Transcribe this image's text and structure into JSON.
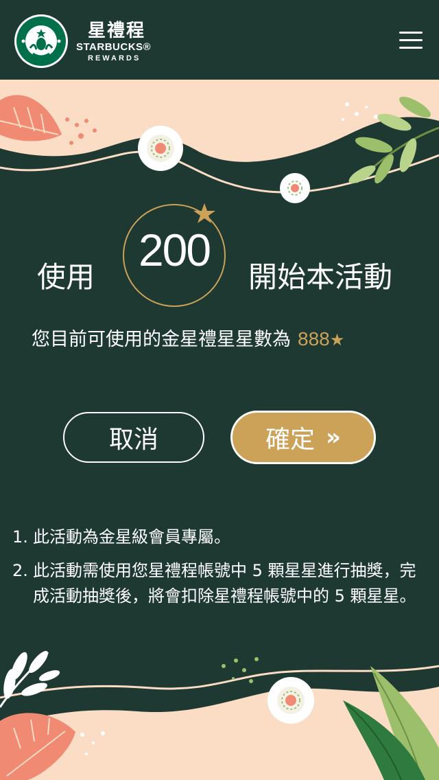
{
  "header": {
    "brand_cn": "星禮程",
    "brand_en": "STARBUCKS®",
    "brand_rewards": "REWARDS",
    "logo_icon": "starbucks-siren-logo",
    "menu_icon": "hamburger-menu-icon"
  },
  "main": {
    "title_left": "使用",
    "points": "200",
    "title_right": "開始本活動",
    "balance_label": "您目前可使用的金星禮星星數為",
    "balance_value": "888",
    "balance_star": "★"
  },
  "buttons": {
    "cancel": "取消",
    "confirm": "確定",
    "confirm_chevron": "»"
  },
  "notes": [
    {
      "num": "1.",
      "text": "此活動為金星級會員專屬。"
    },
    {
      "num": "2.",
      "text": "此活動需使用您星禮程帳號中 5 顆星星進行抽獎，完成活動抽獎後，將會扣除星禮程帳號中的 5 顆星星。"
    }
  ],
  "colors": {
    "background": "#1e3932",
    "accent_gold": "#cba258",
    "peach": "#fbdcc4",
    "coral": "#f08a72",
    "leaf_green": "#9bbf6b"
  }
}
